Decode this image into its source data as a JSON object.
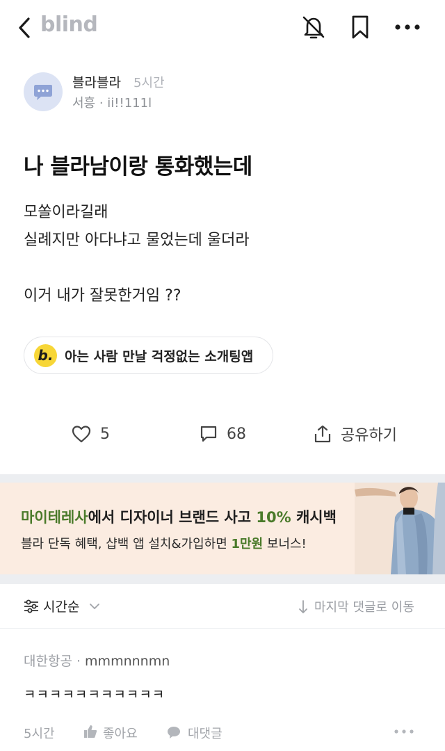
{
  "header": {
    "logo": "blind",
    "back_icon": "chevron-left-icon",
    "bell_icon": "bell-off-icon",
    "bookmark_icon": "bookmark-icon",
    "more_icon": "more-horizontal-icon"
  },
  "post": {
    "author_name": "블라블라",
    "time": "5시간",
    "meta": "서흥 · ii!!111l",
    "title": "나 블라남이랑 통화했는데",
    "body_lines": [
      "모쏠이라길래",
      "실례지만 아다냐고 물었는데 울더라",
      "",
      "이거 내가 잘못한거임 ??"
    ]
  },
  "promo": {
    "badge": "b.",
    "text": "아는 사람 만날 걱정없는 소개팅앱",
    "badge_color": "#f7d637"
  },
  "actions": {
    "likes": "5",
    "comments": "68",
    "share_label": "공유하기"
  },
  "ad": {
    "line1_brand": "마이테레사",
    "line1_mid": "에서 디자이너 브랜드 사고 ",
    "line1_accent": "10%",
    "line1_end": " 캐시백",
    "line2_start": "블라 단독 혜택, 샵백 앱 설치&가입하면 ",
    "line2_accent": "1만원",
    "line2_end": " 보너스!",
    "accent_color": "#4a7a2a",
    "background": "#fbece1"
  },
  "sort": {
    "label": "시간순",
    "jump_label": "마지막 댓글로 이동"
  },
  "comment": {
    "company": "대한항공",
    "nickname": "mmmnnnmn",
    "text": "ㅋㅋㅋㅋㅋㅋㅋㅋㅋㅋㅋ",
    "time": "5시간",
    "like_label": "좋아요",
    "reply_label": "대댓글"
  }
}
